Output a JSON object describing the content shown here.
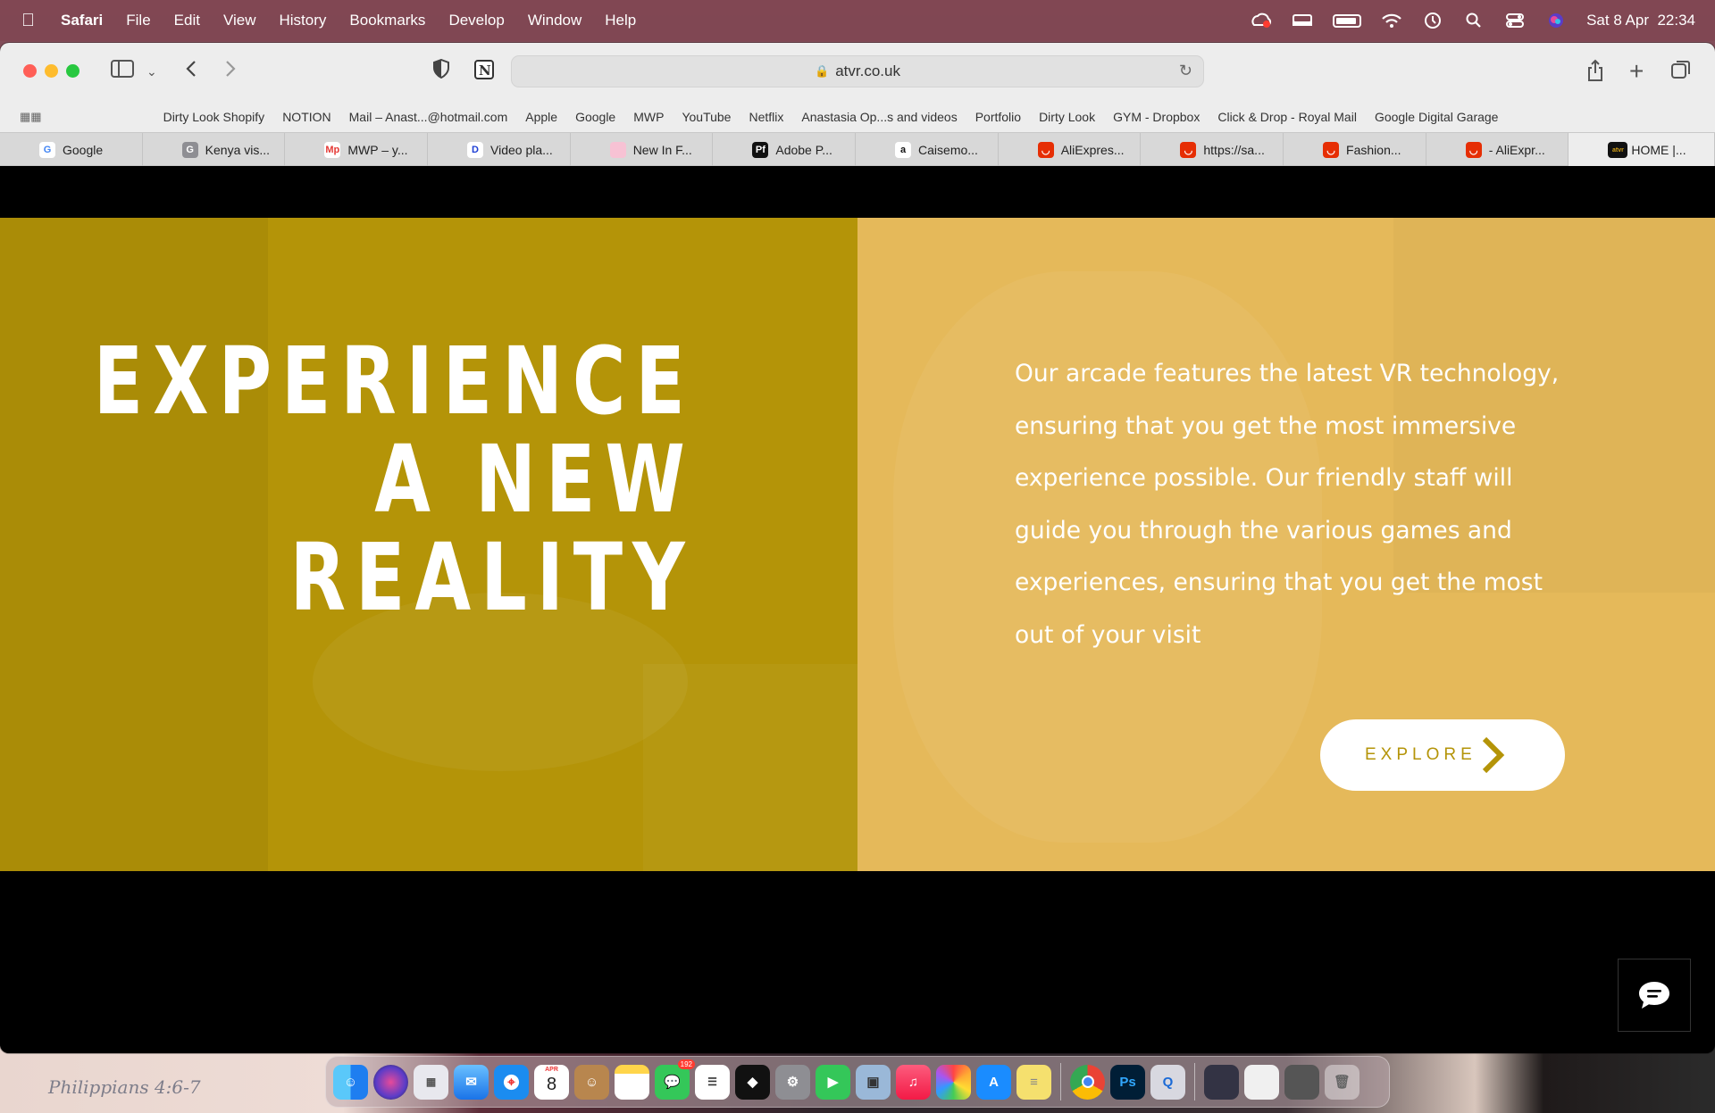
{
  "menubar": {
    "app_name": "Safari",
    "items": [
      "File",
      "Edit",
      "View",
      "History",
      "Bookmarks",
      "Develop",
      "Window",
      "Help"
    ],
    "datetime": "Sat 8 Apr  22:34"
  },
  "toolbar": {
    "url": "atvr.co.uk"
  },
  "bookmarks": [
    "Dirty Look Shopify",
    "NOTION",
    "Mail – Anast...@hotmail.com",
    "Apple",
    "Google",
    "MWP",
    "YouTube",
    "Netflix",
    "Anastasia Op...s and videos",
    "Portfolio",
    "Dirty Look",
    "GYM - Dropbox",
    "Click & Drop - Royal Mail",
    "Google Digital Garage"
  ],
  "tabs": [
    {
      "label": "Google",
      "icon": "google-icon",
      "color": "#ffffff",
      "glyph": "G",
      "glyph_color": "#4285f4"
    },
    {
      "label": "Kenya vis...",
      "icon": "kenya-icon",
      "color": "#8e8e93",
      "glyph": "G",
      "glyph_color": "#ffffff"
    },
    {
      "label": "MWP – y...",
      "icon": "mwp-icon",
      "color": "#ffffff",
      "glyph": "Mp",
      "glyph_color": "#e53935"
    },
    {
      "label": "Video pla...",
      "icon": "disney-icon",
      "color": "#ffffff",
      "glyph": "D",
      "glyph_color": "#1e3fd4"
    },
    {
      "label": "New In F...",
      "icon": "newin-icon",
      "color": "#f7c2d4",
      "glyph": "",
      "glyph_color": "#ffffff"
    },
    {
      "label": "Adobe P...",
      "icon": "adobe-portfolio-icon",
      "color": "#111111",
      "glyph": "Pf",
      "glyph_color": "#ffffff"
    },
    {
      "label": "Caisemo...",
      "icon": "amazon-icon",
      "color": "#ffffff",
      "glyph": "a",
      "glyph_color": "#111111"
    },
    {
      "label": "AliExpres...",
      "icon": "aliexpress-icon",
      "color": "#e62e04",
      "glyph": "◡",
      "glyph_color": "#ffffff"
    },
    {
      "label": "https://sa...",
      "icon": "aliexpress-icon",
      "color": "#e62e04",
      "glyph": "◡",
      "glyph_color": "#ffffff"
    },
    {
      "label": "Fashion...",
      "icon": "aliexpress-icon",
      "color": "#e62e04",
      "glyph": "◡",
      "glyph_color": "#ffffff"
    },
    {
      "label": "- AliExpr...",
      "icon": "aliexpress-icon",
      "color": "#e62e04",
      "glyph": "◡",
      "glyph_color": "#ffffff"
    },
    {
      "label": "HOME |...",
      "icon": "atvr-icon",
      "color": "#111111",
      "glyph": "atvr",
      "glyph_color": "#d4a017",
      "active": true
    }
  ],
  "hero": {
    "title_lines": [
      "EXPERIENCE",
      "A NEW",
      "REALITY"
    ],
    "description": "Our arcade features the latest VR technology, ensuring that you get the most immersive experience possible. Our friendly staff will guide you through the various games and experiences, ensuring that you get the most out of your visit",
    "button_label": "EXPLORE",
    "colors": {
      "left": "#b49408",
      "right": "#e5b95a",
      "accent": "#b49408"
    }
  },
  "wallpaper_text": "Philippians 4:6-7",
  "dock": {
    "calendar_month": "APR",
    "calendar_day": "8",
    "messages_badge": "192",
    "apps": [
      "finder",
      "siri",
      "launchpad",
      "mail",
      "safari",
      "calendar",
      "contacts",
      "notes",
      "messages",
      "reminders",
      "tidal",
      "settings",
      "facetime",
      "preview",
      "music",
      "photos",
      "app-store",
      "stickies",
      "chrome",
      "photoshop",
      "quicktime",
      "window1",
      "window2",
      "window3",
      "trash"
    ]
  }
}
